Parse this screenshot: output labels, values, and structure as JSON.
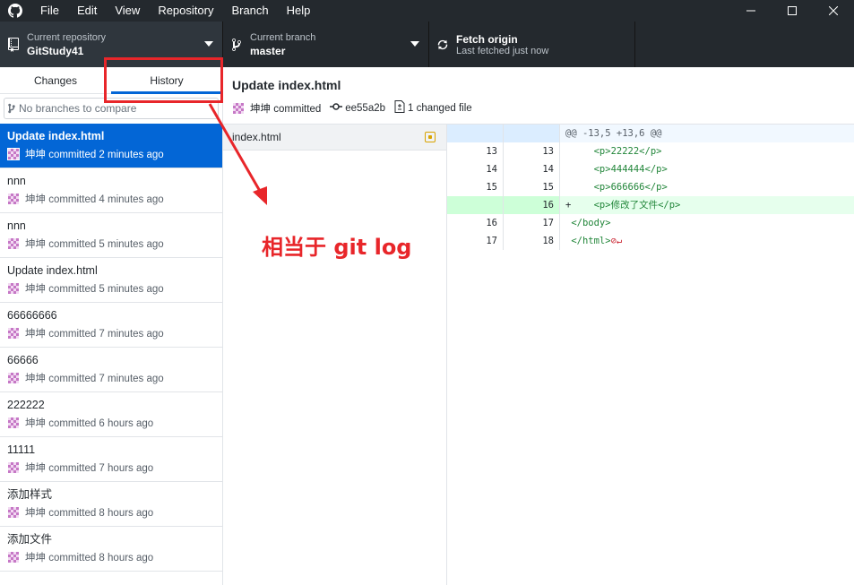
{
  "titlebar": {
    "menu": [
      "File",
      "Edit",
      "View",
      "Repository",
      "Branch",
      "Help"
    ],
    "window_controls": [
      "minimize",
      "maximize",
      "close"
    ]
  },
  "toolbar": {
    "repository": {
      "label": "Current repository",
      "value": "GitStudy41"
    },
    "branch": {
      "label": "Current branch",
      "value": "master"
    },
    "fetch": {
      "label": "Fetch origin",
      "value": "Last fetched just now"
    }
  },
  "sidebar": {
    "tabs": [
      {
        "label": "Changes",
        "active": false
      },
      {
        "label": "History",
        "active": true
      }
    ],
    "branch_compare_placeholder": "No branches to compare",
    "commits": [
      {
        "summary": "Update index.html",
        "meta": "坤坤 committed 2 minutes ago",
        "selected": true
      },
      {
        "summary": "nnn",
        "meta": "坤坤 committed 4 minutes ago",
        "selected": false
      },
      {
        "summary": "nnn",
        "meta": "坤坤 committed 5 minutes ago",
        "selected": false
      },
      {
        "summary": "Update index.html",
        "meta": "坤坤 committed 5 minutes ago",
        "selected": false
      },
      {
        "summary": "66666666",
        "meta": "坤坤 committed 7 minutes ago",
        "selected": false
      },
      {
        "summary": "66666",
        "meta": "坤坤 committed 7 minutes ago",
        "selected": false
      },
      {
        "summary": "222222",
        "meta": "坤坤 committed 6 hours ago",
        "selected": false
      },
      {
        "summary": "11111",
        "meta": "坤坤 committed 7 hours ago",
        "selected": false
      },
      {
        "summary": "添加样式",
        "meta": "坤坤 committed 8 hours ago",
        "selected": false
      },
      {
        "summary": "添加文件",
        "meta": "坤坤 committed 8 hours ago",
        "selected": false
      }
    ]
  },
  "commit_detail": {
    "title": "Update index.html",
    "author": "坤坤 committed",
    "sha": "ee55a2b",
    "changed_files": "1 changed file"
  },
  "files": [
    {
      "name": "index.html",
      "status": "modified"
    }
  ],
  "diff": {
    "hunk_header": "@@ -13,5 +13,6 @@",
    "lines": [
      {
        "old": "13",
        "new": "13",
        "type": "context",
        "prefix": " ",
        "text": "    <p>22222</p>"
      },
      {
        "old": "14",
        "new": "14",
        "type": "context",
        "prefix": " ",
        "text": "    <p>444444</p>"
      },
      {
        "old": "15",
        "new": "15",
        "type": "context",
        "prefix": " ",
        "text": "    <p>666666</p>"
      },
      {
        "old": "",
        "new": "16",
        "type": "add",
        "prefix": "+",
        "text": "    <p>修改了文件</p>"
      },
      {
        "old": "16",
        "new": "17",
        "type": "context",
        "prefix": " ",
        "text": "</body>"
      },
      {
        "old": "17",
        "new": "18",
        "type": "context",
        "prefix": " ",
        "text": "</html>"
      }
    ]
  },
  "annotation": {
    "text": "相当于 git log",
    "color": "#e8262a"
  },
  "colors": {
    "titlebar_bg": "#24292e",
    "selected_bg": "#0366d6",
    "added_bg": "#e6ffed",
    "annotation": "#e8262a"
  }
}
